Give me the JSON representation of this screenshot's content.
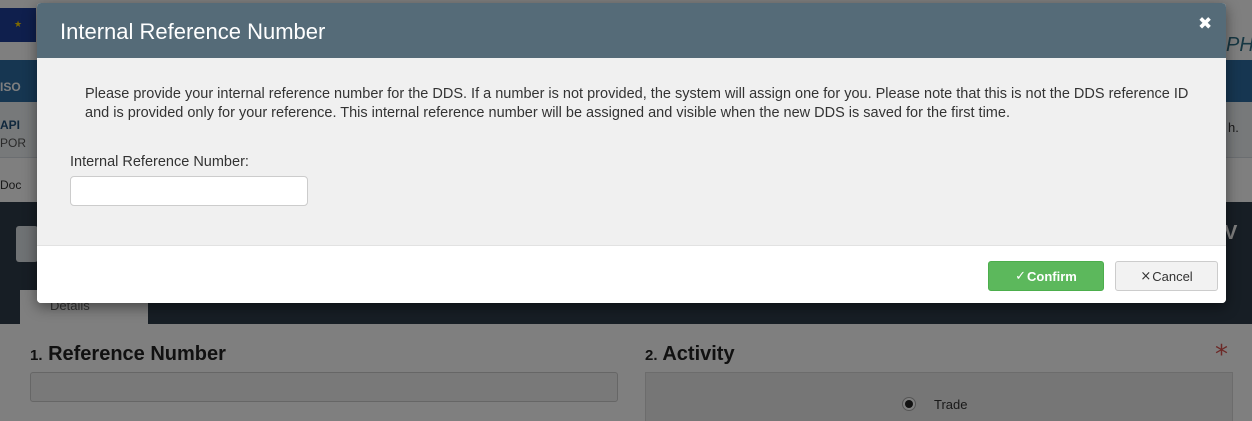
{
  "background": {
    "brand_fragment": "PHA",
    "nav_fragment": "ISO",
    "submenu_api": "API",
    "submenu_por": "POR",
    "submenu_right": "h.",
    "breadcrumb_fragment": "Doc",
    "heading_fragment": "V",
    "tab_label": "Details",
    "section_reference": {
      "number": "1.",
      "label": "Reference Number"
    },
    "section_activity": {
      "number": "2.",
      "label": "Activity",
      "required_mark": "*"
    },
    "activity_option": "Trade"
  },
  "modal": {
    "title": "Internal Reference Number",
    "close_glyph": "✖",
    "description": "Please provide your internal reference number for the DDS. If a number is not provided, the system will assign one for you. Please note that this is not the DDS reference ID and is provided only for your reference. This internal reference number will be assigned and visible when the new DDS is saved for the first time.",
    "field_label": "Internal Reference Number:",
    "field_value": "",
    "field_placeholder": "",
    "confirm_icon": "✓",
    "confirm_label": "Confirm",
    "cancel_icon": "×",
    "cancel_label": "Cancel"
  },
  "colors": {
    "modal_header": "#556b78",
    "confirm_button": "#5cb85c",
    "required_star": "#d9534f"
  }
}
